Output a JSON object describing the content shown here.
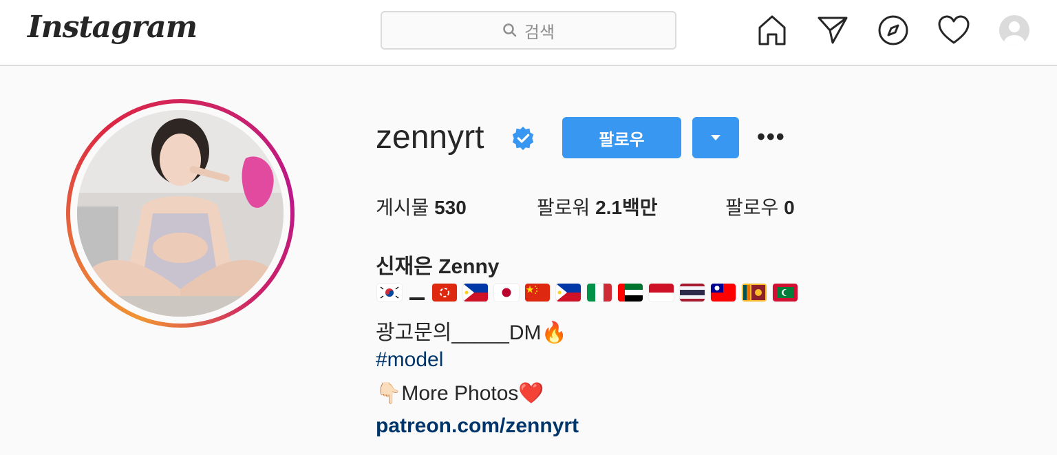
{
  "header": {
    "logo_text": "Instagram",
    "search_placeholder": "검색",
    "icons": [
      "home-icon",
      "direct-icon",
      "explore-icon",
      "activity-heart-icon",
      "user-avatar-icon"
    ]
  },
  "profile": {
    "username": "zennyrt",
    "verified": true,
    "follow_label": "팔로우",
    "stats": {
      "posts_label": "게시물",
      "posts_value": "530",
      "followers_label": "팔로워",
      "followers_value": "2.1백만",
      "following_label": "팔로우",
      "following_value": "0"
    },
    "bio": {
      "name": "신재은 Zenny",
      "flags": [
        "south-korea-flag",
        "hong-kong-flag",
        "philippines-flag",
        "japan-flag",
        "china-flag",
        "philippines-flag",
        "italy-flag",
        "uae-flag",
        "indonesia-flag",
        "thailand-flag",
        "taiwan-flag",
        "sri-lanka-flag",
        "maldives-flag"
      ],
      "ad_line": "광고문의_____DM🔥",
      "hashtag": "#model",
      "more_photos": "👇🏻More Photos❤️",
      "website": "patreon.com/zennyrt"
    }
  },
  "colors": {
    "accent": "#3897f0",
    "link": "#003569",
    "text": "#262626",
    "background": "#fafafa",
    "border": "#dbdbdb"
  }
}
